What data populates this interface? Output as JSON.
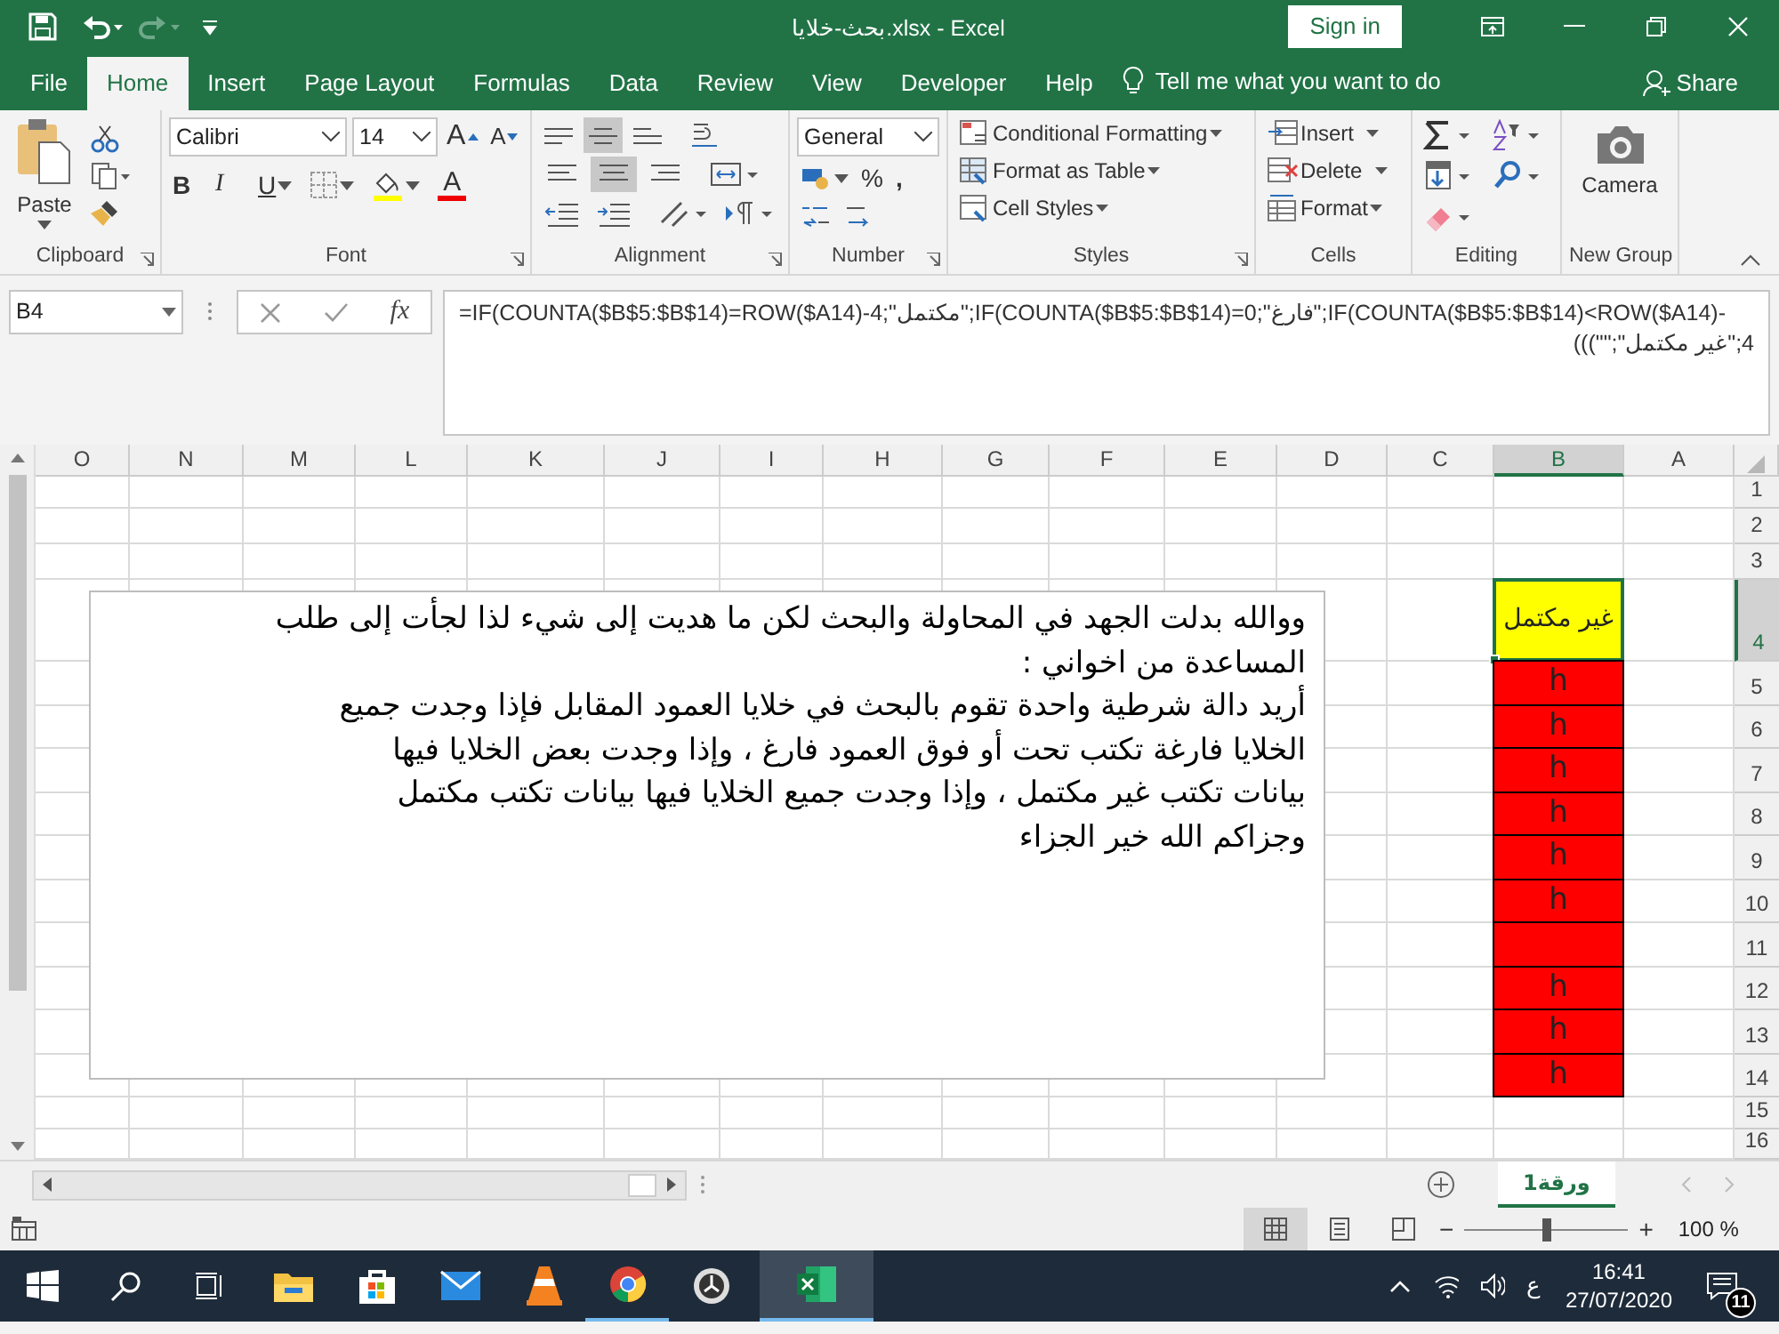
{
  "title_bar": {
    "title": "بحث-خلايا.xlsx - Excel",
    "sign_in": "Sign in"
  },
  "tabs": [
    {
      "label": "File",
      "selected": false
    },
    {
      "label": "Home",
      "selected": true
    },
    {
      "label": "Insert",
      "selected": false
    },
    {
      "label": "Page Layout",
      "selected": false
    },
    {
      "label": "Formulas",
      "selected": false
    },
    {
      "label": "Data",
      "selected": false
    },
    {
      "label": "Review",
      "selected": false
    },
    {
      "label": "View",
      "selected": false
    },
    {
      "label": "Developer",
      "selected": false
    },
    {
      "label": "Help",
      "selected": false
    }
  ],
  "tell_me": "Tell me what you want to do",
  "share": "Share",
  "ribbon": {
    "paste": "Paste",
    "font_name": "Calibri",
    "font_size": "14",
    "grow_font": "A",
    "shrink_font": "A",
    "bold": "B",
    "italic": "I",
    "underline": "U",
    "font_color": "A",
    "vertical_alignment": [
      {
        "selected": false
      },
      {
        "selected": true
      },
      {
        "selected": false
      }
    ],
    "horizontal_alignment": [
      {
        "selected": false
      },
      {
        "selected": true
      },
      {
        "selected": false
      }
    ],
    "number_format": "General",
    "percent": "%",
    "comma": ",",
    "conditional_formatting": "Conditional Formatting",
    "format_as_table": "Format as Table",
    "cell_styles": "Cell Styles",
    "insert": "Insert",
    "delete": "Delete",
    "format": "Format",
    "camera": "Camera",
    "groups": [
      "Clipboard",
      "Font",
      "Alignment",
      "Number",
      "Styles",
      "Cells",
      "Editing",
      "New Group"
    ]
  },
  "formula_bar": {
    "name_box": "B4",
    "fx": "fx",
    "lines": [
      "=IF(COUNTA($B$5:$B$14)=ROW($A14)-4;\"مكتمل\";IF(COUNTA($B$5:$B$14)=0;\"فارغ\";IF(COUNTA($B$5:$B$14)<ROW($A14)-",
      "4;\"غير مكتمل\";\"\")))"
    ]
  },
  "sheet": {
    "columns": [
      {
        "label": "O",
        "selected": false
      },
      {
        "label": "N",
        "selected": false
      },
      {
        "label": "M",
        "selected": false
      },
      {
        "label": "L",
        "selected": false
      },
      {
        "label": "K",
        "selected": false
      },
      {
        "label": "J",
        "selected": false
      },
      {
        "label": "I",
        "selected": false
      },
      {
        "label": "H",
        "selected": false
      },
      {
        "label": "G",
        "selected": false
      },
      {
        "label": "F",
        "selected": false
      },
      {
        "label": "E",
        "selected": false
      },
      {
        "label": "D",
        "selected": false
      },
      {
        "label": "C",
        "selected": false
      },
      {
        "label": "B",
        "selected": true
      },
      {
        "label": "A",
        "selected": false
      }
    ],
    "rows": [
      {
        "label": "1",
        "selected": false
      },
      {
        "label": "2",
        "selected": false
      },
      {
        "label": "3",
        "selected": false
      },
      {
        "label": "4",
        "selected": true,
        "b": "غير مكتمل",
        "color": "#ffff00"
      },
      {
        "label": "5",
        "selected": false,
        "b": "h",
        "color": "#ff0000"
      },
      {
        "label": "6",
        "selected": false,
        "b": "h",
        "color": "#ff0000"
      },
      {
        "label": "7",
        "selected": false,
        "b": "h",
        "color": "#ff0000"
      },
      {
        "label": "8",
        "selected": false,
        "b": "h",
        "color": "#ff0000"
      },
      {
        "label": "9",
        "selected": false,
        "b": "h",
        "color": "#ff0000"
      },
      {
        "label": "10",
        "selected": false,
        "b": "h",
        "color": "#ff0000"
      },
      {
        "label": "11",
        "selected": false,
        "color": "#ff0000"
      },
      {
        "label": "12",
        "selected": false,
        "b": "h",
        "color": "#ff0000"
      },
      {
        "label": "13",
        "selected": false,
        "b": "h",
        "color": "#ff0000"
      },
      {
        "label": "14",
        "selected": false,
        "b": "h",
        "color": "#ff0000"
      },
      {
        "label": "15",
        "selected": false
      },
      {
        "label": "16",
        "selected": false
      }
    ]
  },
  "text_box": {
    "lines": [
      "ووالله بدلت الجهد في المحاولة والبحث لكن ما هديت إلى شيء لذا لجأت إلى طلب",
      "المساعدة من اخواني :",
      "أريد دالة شرطية واحدة تقوم بالبحث في خلايا العمود المقابل فإذا وجدت جميع",
      "الخلايا فارغة تكتب تحت أو فوق العمود فارغ ، وإذا وجدت بعض الخلايا فيها",
      "بيانات تكتب غير مكتمل ، وإذا وجدت جميع الخلايا فيها بيانات تكتب مكتمل",
      "وجزاكم الله خير الجزاء"
    ]
  },
  "sheet_tabs": [
    {
      "label": "ورقة1",
      "selected": true
    }
  ],
  "status_bar": {
    "zoom_out": "−",
    "zoom_in": "+",
    "zoom": {
      "level": 0.5,
      "reading": "100 %"
    }
  },
  "taskbar": {
    "input_language": "ع",
    "time": "16:41",
    "date": "27/07/2020",
    "notifications": "11"
  }
}
